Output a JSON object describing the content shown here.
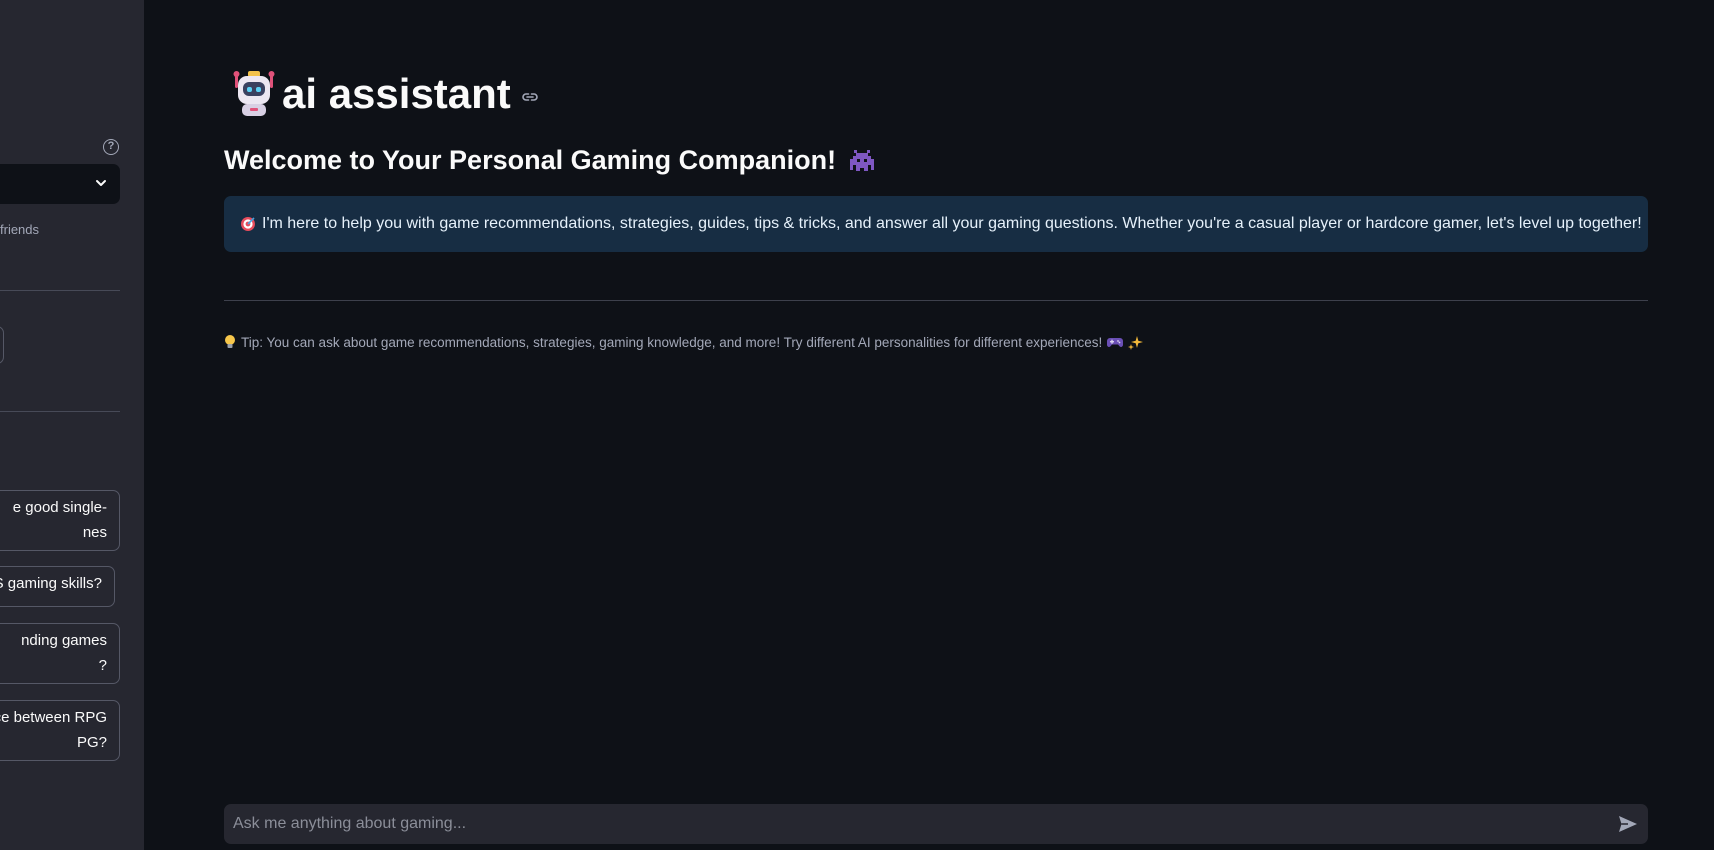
{
  "sidebar": {
    "help_symbol": "?",
    "select_caption": "friends",
    "suggestions": [
      {
        "label": "e good single-\nnes"
      },
      {
        "label": "S gaming skills?"
      },
      {
        "label": "nding games\n?"
      },
      {
        "label": "ce between RPG\nPG?"
      }
    ]
  },
  "header": {
    "title": "ai assistant",
    "subtitle": "Welcome to Your Personal Gaming Companion!"
  },
  "info": {
    "text": "I'm here to help you with game recommendations, strategies, guides, tips & tricks, and answer all your gaming questions. Whether you're a casual player or hardcore gamer, let's level up together!"
  },
  "tip": {
    "text": "Tip: You can ask about game recommendations, strategies, gaming knowledge, and more! Try different AI personalities for different experiences!"
  },
  "chat": {
    "placeholder": "Ask me anything about gaming..."
  },
  "colors": {
    "background": "#0e1117",
    "sidebar": "#262730",
    "info_box": "#172d43"
  }
}
